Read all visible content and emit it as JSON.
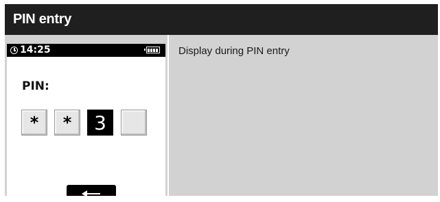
{
  "header": {
    "title": "PIN entry"
  },
  "device": {
    "status_bar": {
      "clock_icon": "clock-icon",
      "time": "14:25",
      "battery_icon": "battery-icon"
    },
    "pin_label": "PIN:",
    "pin_digits": [
      "*",
      "*",
      "3",
      ""
    ],
    "active_digit_index": 2,
    "back_button": {
      "icon": "back-arrow-icon"
    }
  },
  "description": "Display during PIN entry",
  "colors": {
    "title_bar": "#1f1f1f",
    "panel_background": "#d2d2d3",
    "screen_background": "#ffffff",
    "status_bar": "#000000",
    "active_digit": "#000000"
  }
}
